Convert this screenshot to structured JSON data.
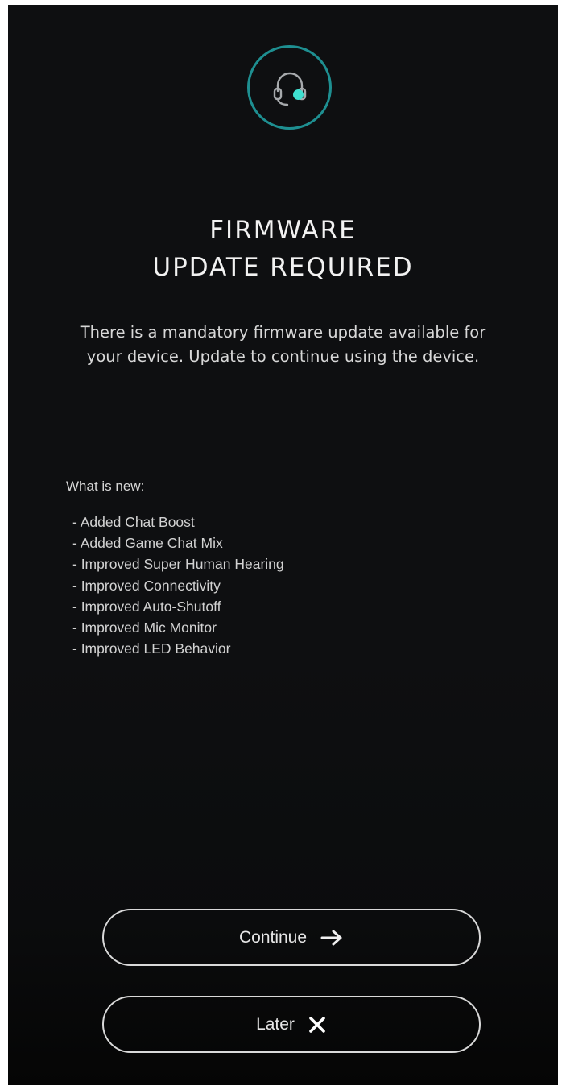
{
  "header": {
    "icon": "headset-icon",
    "title_line1": "FIRMWARE",
    "title_line2": "UPDATE REQUIRED"
  },
  "description": "There is a mandatory firmware update available for your device. Update to continue using the device.",
  "whats_new": {
    "label": "What is new:",
    "items": [
      "- Added Chat Boost",
      "- Added Game Chat Mix",
      "- Improved Super Human Hearing",
      "- Improved Connectivity",
      "- Improved Auto-Shutoff",
      "- Improved Mic Monitor",
      "- Improved LED Behavior"
    ]
  },
  "buttons": {
    "continue_label": "Continue",
    "continue_icon": "arrow-right-icon",
    "later_label": "Later",
    "later_icon": "close-icon"
  },
  "colors": {
    "background": "#0e0f11",
    "accent_ring": "#1e8f91",
    "status_dot": "#3fe0d0",
    "text": "#ffffff"
  }
}
